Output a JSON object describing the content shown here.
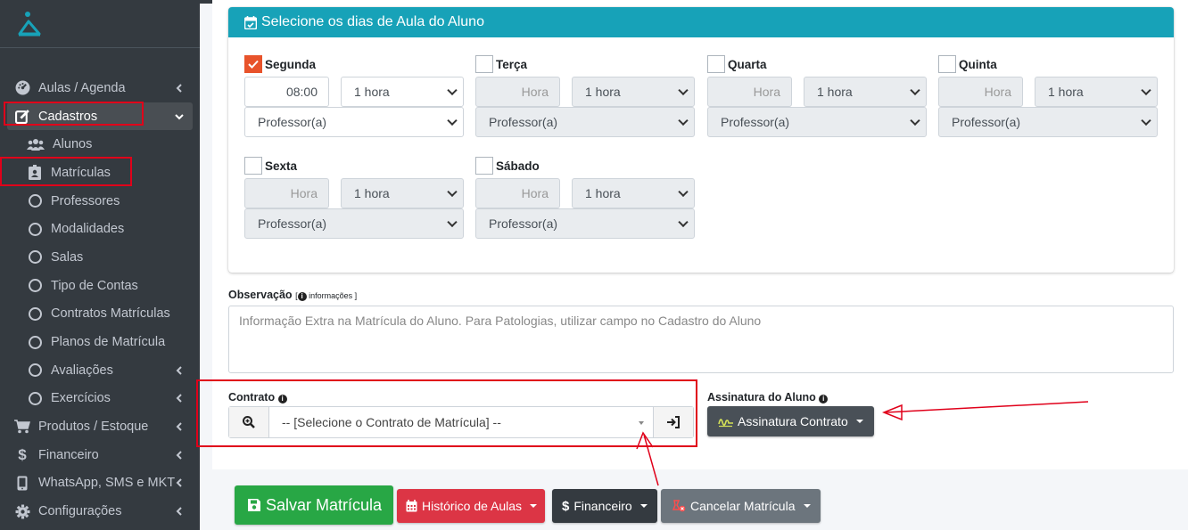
{
  "sidebar": {
    "items": [
      {
        "label": "Aulas / Agenda",
        "icon": "tachometer-icon"
      },
      {
        "label": "Cadastros",
        "icon": "edit-icon"
      },
      {
        "label": "Alunos",
        "icon": "users-icon"
      },
      {
        "label": "Matrículas",
        "icon": "id-badge-icon"
      },
      {
        "label": "Professores",
        "icon": "circle-icon"
      },
      {
        "label": "Modalidades",
        "icon": "circle-icon"
      },
      {
        "label": "Salas",
        "icon": "circle-icon"
      },
      {
        "label": "Tipo de Contas",
        "icon": "circle-icon"
      },
      {
        "label": "Contratos Matrículas",
        "icon": "circle-icon"
      },
      {
        "label": "Planos de Matrícula",
        "icon": "circle-icon"
      },
      {
        "label": "Avaliações",
        "icon": "circle-icon"
      },
      {
        "label": "Exercícios",
        "icon": "circle-icon"
      },
      {
        "label": "Produtos / Estoque",
        "icon": "cart-icon"
      },
      {
        "label": "Financeiro",
        "icon": "dollar-icon"
      },
      {
        "label": "WhatsApp, SMS e MKT",
        "icon": "phone-icon"
      },
      {
        "label": "Configurações",
        "icon": "gear-icon"
      }
    ]
  },
  "schedule": {
    "title": "Selecione os dias de Aula do Aluno",
    "days": [
      {
        "name": "Segunda",
        "checked": true,
        "time": "08:00",
        "duration": "1 hora",
        "teacher": "Professor(a)"
      },
      {
        "name": "Terça",
        "checked": false,
        "time": "Hora",
        "duration": "1 hora",
        "teacher": "Professor(a)"
      },
      {
        "name": "Quarta",
        "checked": false,
        "time": "Hora",
        "duration": "1 hora",
        "teacher": "Professor(a)"
      },
      {
        "name": "Quinta",
        "checked": false,
        "time": "Hora",
        "duration": "1 hora",
        "teacher": "Professor(a)"
      },
      {
        "name": "Sexta",
        "checked": false,
        "time": "Hora",
        "duration": "1 hora",
        "teacher": "Professor(a)"
      },
      {
        "name": "Sábado",
        "checked": false,
        "time": "Hora",
        "duration": "1 hora",
        "teacher": "Professor(a)"
      }
    ]
  },
  "observacao": {
    "label": "Observação",
    "info_label": "informações",
    "open_bracket": "[",
    "close_bracket": "]",
    "placeholder": "Informação Extra na Matrícula do Aluno. Para Patologias, utilizar campo no Cadastro do Aluno"
  },
  "contrato": {
    "label": "Contrato",
    "select_value": "-- [Selecione o Contrato de Matrícula] --"
  },
  "assinatura": {
    "label": "Assinatura do Aluno",
    "button": "Assinatura Contrato"
  },
  "footer": {
    "save": "Salvar Matrícula",
    "history": "Histórico de Aulas",
    "finance": "Financeiro",
    "cancel": "Cancelar Matrícula"
  },
  "colors": {
    "sidebar_bg": "#343a40",
    "header_teal": "#17a2b8",
    "checkbox_orange": "#e8532b",
    "annotation_red": "#e0001a",
    "save_green": "#28a745",
    "danger_red": "#dc3545"
  }
}
